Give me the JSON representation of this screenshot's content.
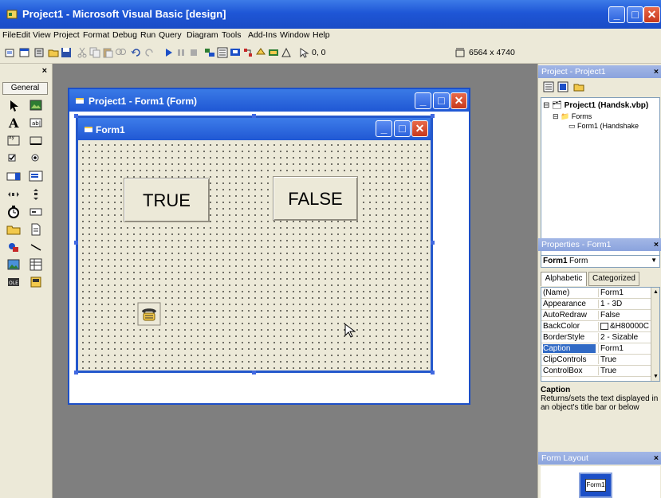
{
  "window": {
    "title": "Project1 - Microsoft Visual Basic [design]",
    "icon": "vb-icon"
  },
  "menu": [
    "File",
    "Edit",
    "View",
    "Project",
    "Format",
    "Debug",
    "Run",
    "Query",
    "Diagram",
    "Tools",
    "Add-Ins",
    "Window",
    "Help"
  ],
  "toolbar": {
    "position": "0, 0",
    "size": "6564 x 4740"
  },
  "toolbox": {
    "tab_label": "General"
  },
  "designer": {
    "title": "Project1 - Form1 (Form)"
  },
  "form": {
    "title": "Form1",
    "buttons": [
      {
        "label": "TRUE"
      },
      {
        "label": "FALSE"
      }
    ]
  },
  "project_panel": {
    "title": "Project - Project1",
    "tree": {
      "project": "Project1 (Handsk.vbp)",
      "folder": "Forms",
      "form": "Form1 (Handshake"
    }
  },
  "properties_panel": {
    "title": "Properties - Form1",
    "object": "Form1",
    "object_type": "Form",
    "tabs": [
      "Alphabetic",
      "Categorized"
    ],
    "rows": [
      {
        "key": "(Name)",
        "value": "Form1"
      },
      {
        "key": "Appearance",
        "value": "1 - 3D"
      },
      {
        "key": "AutoRedraw",
        "value": "False"
      },
      {
        "key": "BackColor",
        "value": "&H80000C"
      },
      {
        "key": "BorderStyle",
        "value": "2 - Sizable"
      },
      {
        "key": "Caption",
        "value": "Form1",
        "selected": true
      },
      {
        "key": "ClipControls",
        "value": "True"
      },
      {
        "key": "ControlBox",
        "value": "True"
      }
    ],
    "desc_title": "Caption",
    "desc_text": "Returns/sets the text displayed in an object's title bar or below"
  },
  "layout_panel": {
    "title": "Form Layout",
    "thumb_label": "Form1"
  },
  "colors": {
    "xp_blue": "#1f57d4",
    "face": "#ece9d8",
    "workspace": "#7f7f7f"
  }
}
